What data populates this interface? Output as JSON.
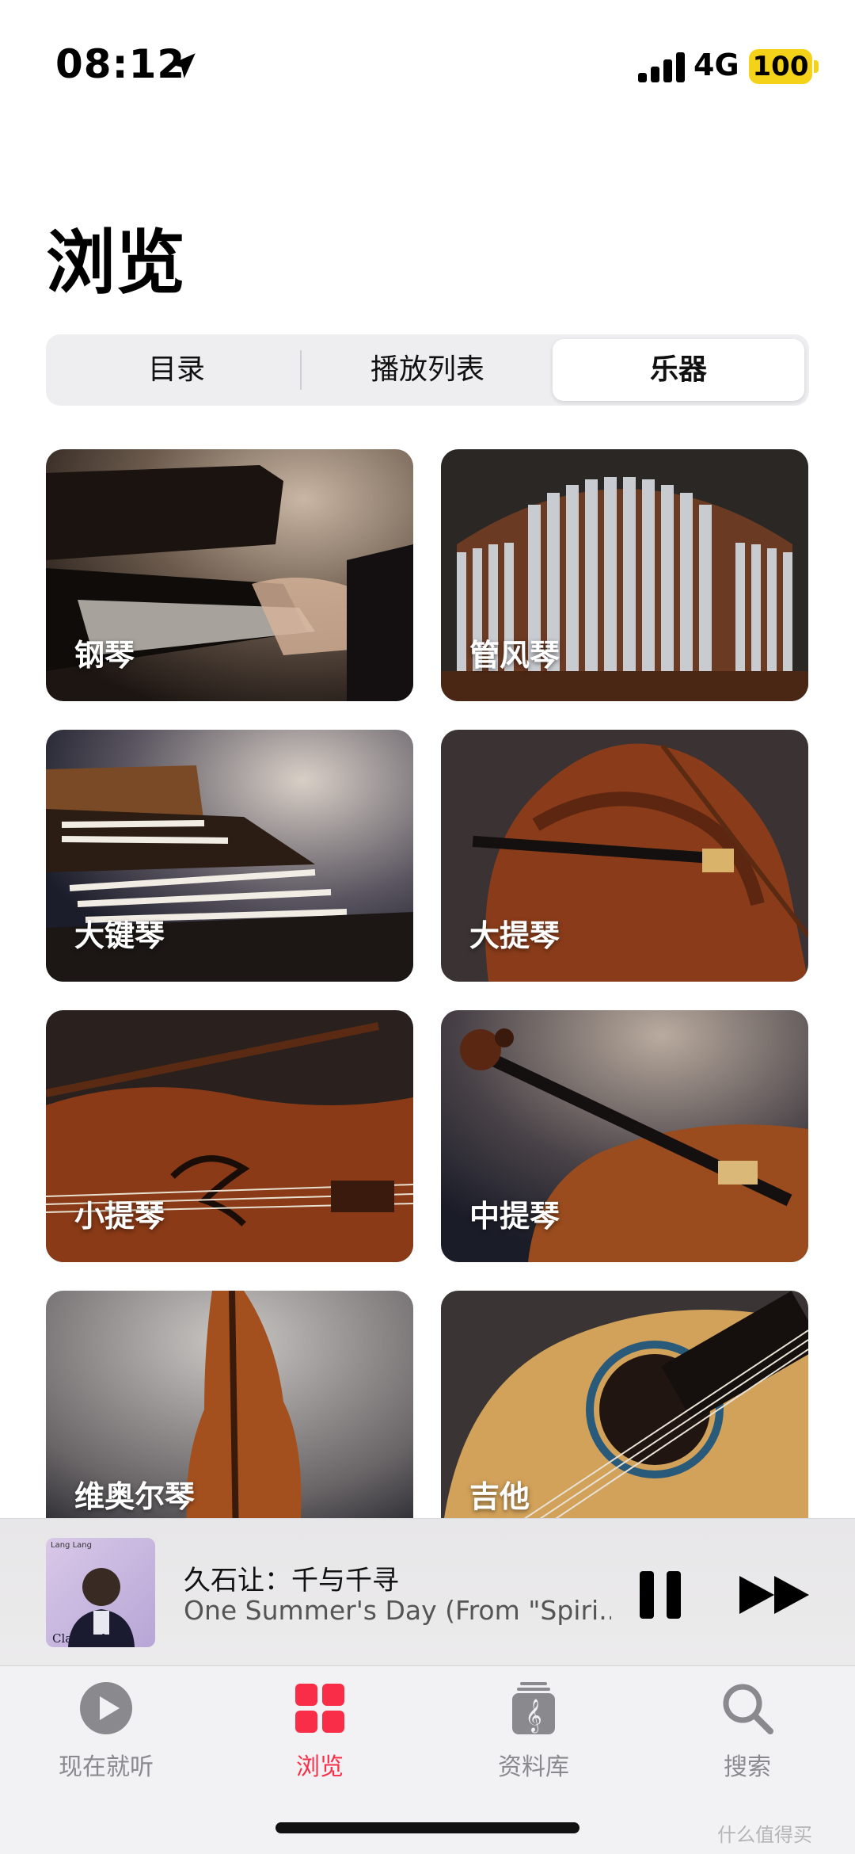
{
  "status_bar": {
    "time": "08:12",
    "network": "4G",
    "battery": "100",
    "battery_color": "#f5d21a"
  },
  "page": {
    "title": "浏览"
  },
  "segments": [
    {
      "label": "目录",
      "active": false
    },
    {
      "label": "播放列表",
      "active": false
    },
    {
      "label": "乐器",
      "active": true
    }
  ],
  "tiles": [
    {
      "label": "钢琴",
      "icon": "piano-image"
    },
    {
      "label": "管风琴",
      "icon": "pipe-organ-image"
    },
    {
      "label": "大键琴",
      "icon": "harpsichord-image"
    },
    {
      "label": "大提琴",
      "icon": "cello-image"
    },
    {
      "label": "小提琴",
      "icon": "violin-image"
    },
    {
      "label": "中提琴",
      "icon": "viola-image"
    },
    {
      "label": "维奥尔琴",
      "icon": "viol-image"
    },
    {
      "label": "吉他",
      "icon": "guitar-image"
    }
  ],
  "mini_player": {
    "title": "久石让：千与千寻",
    "subtitle": "One Summer's Day (From \"Spiri...",
    "artwork_top_text": "Lang Lang",
    "artwork_bottom_text": "Classical Session"
  },
  "tabs": [
    {
      "label": "现在就听",
      "icon": "play-circle-icon",
      "active": false
    },
    {
      "label": "浏览",
      "icon": "grid-icon",
      "active": true
    },
    {
      "label": "资料库",
      "icon": "library-icon",
      "active": false
    },
    {
      "label": "搜索",
      "icon": "search-icon",
      "active": false
    }
  ],
  "accent_color": "#fa2d48",
  "watermark": "什么值得买"
}
